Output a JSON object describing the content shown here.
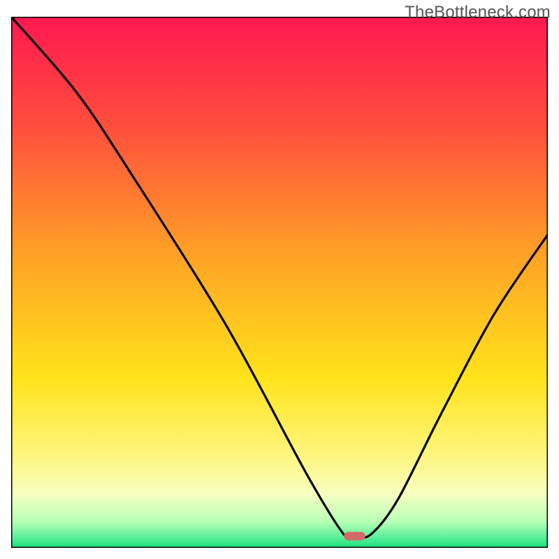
{
  "watermark": "TheBottleneck.com",
  "chart_data": {
    "type": "line",
    "title": "",
    "xlabel": "",
    "ylabel": "",
    "xlim": [
      0,
      100
    ],
    "ylim": [
      0,
      100
    ],
    "grid": false,
    "legend": false,
    "series": [
      {
        "name": "bottleneck-curve",
        "x": [
          0,
          12,
          22,
          40,
          55,
          62,
          64,
          67,
          72,
          80,
          90,
          100
        ],
        "values": [
          100,
          86,
          71,
          42,
          14,
          2.5,
          2.2,
          2.5,
          9,
          25,
          44,
          59
        ]
      }
    ],
    "marker": {
      "x": 64,
      "y": 2.2,
      "color": "#d36a6a",
      "width": 4,
      "height": 1.6
    },
    "gradient_stops": [
      {
        "offset": 0.0,
        "color": "#ff1850"
      },
      {
        "offset": 0.2,
        "color": "#ff4c3e"
      },
      {
        "offset": 0.45,
        "color": "#ffa225"
      },
      {
        "offset": 0.68,
        "color": "#ffe31a"
      },
      {
        "offset": 0.82,
        "color": "#fff57a"
      },
      {
        "offset": 0.9,
        "color": "#f6ffc0"
      },
      {
        "offset": 0.95,
        "color": "#b8ffb6"
      },
      {
        "offset": 0.98,
        "color": "#5cf09a"
      },
      {
        "offset": 1.0,
        "color": "#17e07e"
      }
    ],
    "frame_color": "#000000",
    "line_color": "#000000",
    "line_width": 3.2
  }
}
